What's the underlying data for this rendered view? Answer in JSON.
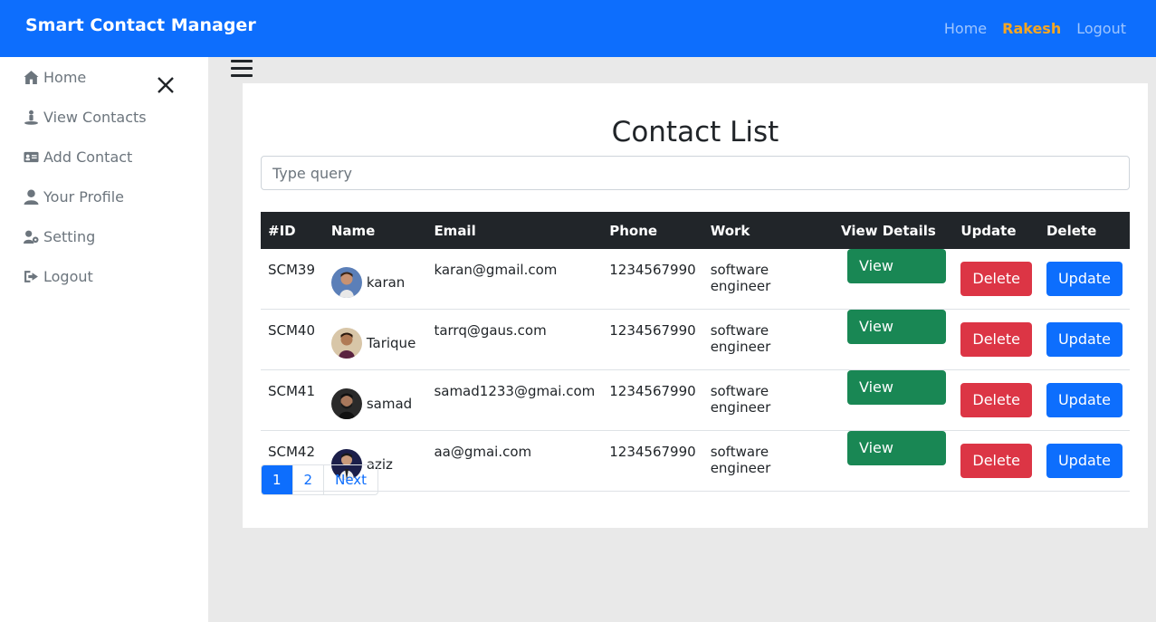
{
  "navbar": {
    "brand": "Smart Contact Manager",
    "links": {
      "home": "Home",
      "user": "Rakesh",
      "logout": "Logout"
    }
  },
  "sidebar": {
    "items": [
      {
        "label": "Home",
        "icon": "home-icon"
      },
      {
        "label": "View Contacts",
        "icon": "contacts-icon"
      },
      {
        "label": "Add Contact",
        "icon": "id-card-icon"
      },
      {
        "label": "Your Profile",
        "icon": "user-icon"
      },
      {
        "label": "Setting",
        "icon": "user-gear-icon"
      },
      {
        "label": "Logout",
        "icon": "sign-out-icon"
      }
    ]
  },
  "main": {
    "title": "Contact List",
    "search_placeholder": "Type query",
    "columns": [
      "#ID",
      "Name",
      "Email",
      "Phone",
      "Work",
      "View Details",
      "Update",
      "Delete"
    ],
    "rows": [
      {
        "id": "SCM39",
        "name": "karan",
        "email": "karan@gmail.com",
        "phone": "1234567990",
        "work": "software engineer"
      },
      {
        "id": "SCM40",
        "name": "Tarique",
        "email": "tarrq@gaus.com",
        "phone": "1234567990",
        "work": "software engineer"
      },
      {
        "id": "SCM41",
        "name": "samad",
        "email": "samad1233@gmai.com",
        "phone": "1234567990",
        "work": "software engineer"
      },
      {
        "id": "SCM42",
        "name": "aziz",
        "email": "aa@gmai.com",
        "phone": "1234567990",
        "work": "software engineer"
      }
    ],
    "buttons": {
      "view": "View Details",
      "delete": "Delete",
      "update": "Update"
    },
    "pagination": {
      "pages": [
        "1",
        "2"
      ],
      "next": "Next",
      "active": "1"
    }
  },
  "colors": {
    "primary": "#0d6efd",
    "success": "#198754",
    "danger": "#dc3545",
    "dark": "#212529",
    "user_highlight": "#f5a623"
  }
}
